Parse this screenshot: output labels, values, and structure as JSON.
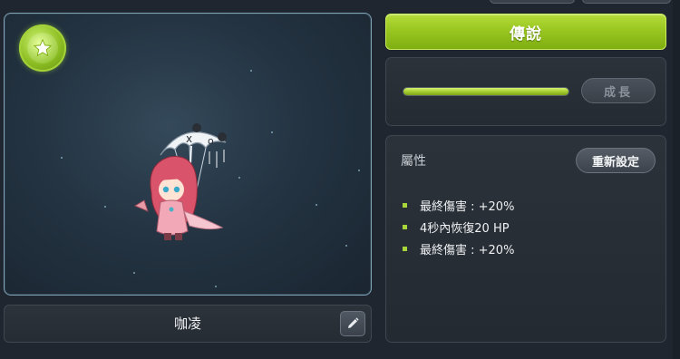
{
  "character": {
    "name": "咖凌",
    "rank_icon": "star-icon"
  },
  "rank_button": {
    "label": "傳說"
  },
  "growth": {
    "button_label": "成長",
    "progress": 1.0
  },
  "attributes": {
    "title": "屬性",
    "reset_label": "重新設定",
    "items": [
      {
        "text": "最終傷害 : +20%"
      },
      {
        "text": "4秒內恢復20 HP"
      },
      {
        "text": "最終傷害 : +20%"
      }
    ]
  },
  "colors": {
    "accent_green": "#97c41e",
    "panel_bg": "#2c323a",
    "preview_border": "#7fa3b8"
  }
}
